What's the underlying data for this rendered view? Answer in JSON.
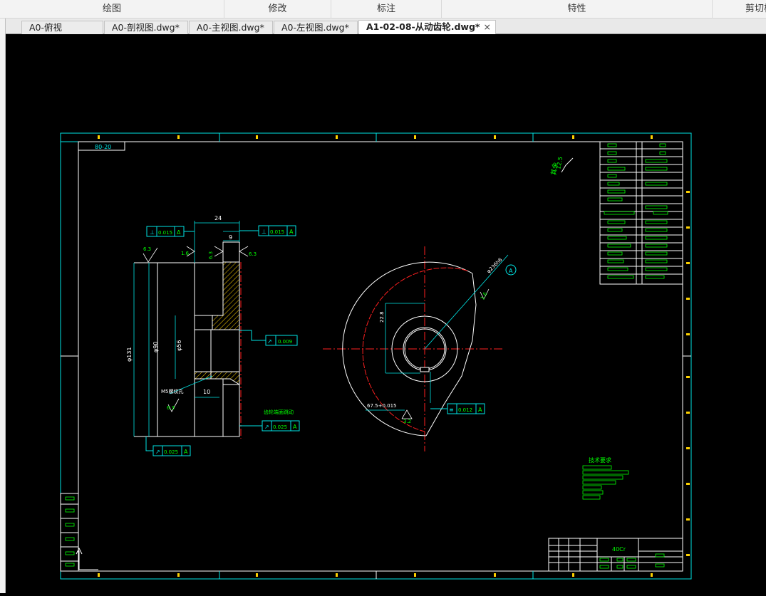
{
  "ribbon": {
    "groups": [
      "绘图",
      "修改",
      "标注",
      "特性",
      "剪切板"
    ]
  },
  "tabs": {
    "items": [
      "A0-俯视图.dwg*",
      "A0-剖视图.dwg*",
      "A0-主视图.dwg*",
      "A0-左视图.dwg*",
      "A1-02-08-从动齿轮.dwg*"
    ],
    "active_index": 4,
    "close_glyph": "×"
  },
  "drawing": {
    "title_ref": "80-20",
    "roughness_other": "其余",
    "roughness_other_val": "12.5",
    "dims": {
      "width_top": "24",
      "width_step": "9",
      "hub_dia": "φ56",
      "bore_dia": "φ90",
      "outer_dia": "φ131",
      "keyway": "10",
      "thread": "M5螺纹孔",
      "ra_63a": "6.3",
      "ra_16": "1.6",
      "ra_63b": "6.3",
      "ra_63c": "6.3",
      "ra_63d": "6.3",
      "ra_32": "3.2",
      "ra_16b": "1.6",
      "key_depth": "22.8",
      "bore_tol": "67.5",
      "bore_tol_txt": "67.5+0.015",
      "tip_dia": "φ236h6",
      "datum_circle": "A",
      "edge_note": "齿轮端面跳动"
    },
    "frames": {
      "perp_left": [
        "⊥",
        "0.015",
        "A"
      ],
      "perp_right": [
        "⊥",
        "0.015",
        "A"
      ],
      "runout_mid": [
        "↗",
        "0.009"
      ],
      "runout_face": [
        "↗",
        "0.025",
        "A"
      ],
      "runout_bottom": [
        "↗",
        "0.025",
        "A"
      ],
      "sym": [
        "≡",
        "0.012",
        "A"
      ]
    },
    "tech_req_title": "技术要求",
    "material": "40Cr"
  },
  "colors": {
    "cad_bg": "#000000",
    "cyan": "#00e5e5",
    "white": "#ffffff",
    "red": "#ff2020",
    "green": "#00ff00",
    "yellow": "#ffd200"
  }
}
